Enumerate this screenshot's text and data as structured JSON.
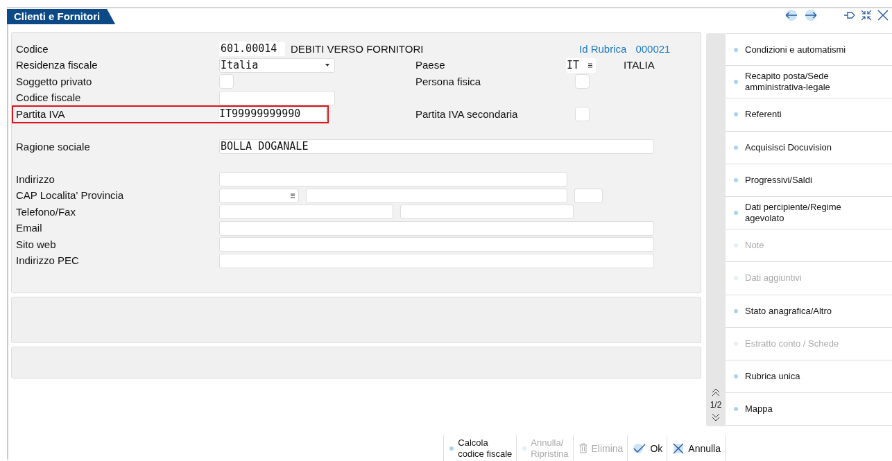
{
  "window": {
    "title": "Clienti e Fornitori"
  },
  "form": {
    "rows": [
      {
        "label": "Codice",
        "inputs": [
          {
            "kind": "code",
            "value": "601.00014"
          }
        ],
        "description": "DEBITI VERSO FORNITORI",
        "right": {
          "kind": "link",
          "label": "Id Rubrica",
          "value": "000021"
        }
      },
      {
        "label": "Residenza fiscale",
        "inputs": [
          {
            "kind": "select",
            "value": "Italia"
          }
        ],
        "right": {
          "kind": "lookup",
          "label": "Paese",
          "value": "IT",
          "description": "ITALIA"
        }
      },
      {
        "label": "Soggetto privato",
        "inputs": [
          {
            "kind": "checkbox",
            "checked": false
          }
        ],
        "right": {
          "kind": "checkbox",
          "label": "Persona fisica",
          "checked": false
        }
      },
      {
        "label": "Codice fiscale",
        "inputs": [
          {
            "kind": "text"
          }
        ]
      },
      {
        "label": "Partita IVA",
        "highlighted": true,
        "inputs": [
          {
            "kind": "text",
            "value": "IT99999999990"
          }
        ],
        "right": {
          "kind": "checkbox",
          "label": "Partita IVA secondaria",
          "checked": false
        }
      },
      {
        "label": "Ragione sociale",
        "gap_before": true,
        "inputs": [
          {
            "kind": "text",
            "value": "BOLLA DOGANALE"
          }
        ]
      },
      {
        "label": "Indirizzo",
        "gap_before": true,
        "inputs": [
          {
            "kind": "text"
          }
        ]
      },
      {
        "label": "CAP Localita' Provincia",
        "inputs": [
          {
            "kind": "lookup"
          },
          {
            "kind": "text"
          },
          {
            "kind": "text"
          }
        ]
      },
      {
        "label": "Telefono/Fax",
        "inputs": [
          {
            "kind": "text"
          },
          {
            "kind": "text"
          }
        ]
      },
      {
        "label": "Email",
        "inputs": [
          {
            "kind": "text"
          }
        ]
      },
      {
        "label": "Sito web",
        "inputs": [
          {
            "kind": "text"
          }
        ]
      },
      {
        "label": "Indirizzo PEC",
        "inputs": [
          {
            "kind": "text"
          }
        ]
      }
    ]
  },
  "pager": {
    "text": "1/2"
  },
  "sidebar": {
    "items": [
      {
        "label": "Condizioni e automatismi",
        "disabled": false
      },
      {
        "label": "Recapito posta/Sede amministrativa-legale",
        "disabled": false
      },
      {
        "label": "Referenti",
        "disabled": false
      },
      {
        "label": "Acquisisci Docuvision",
        "disabled": false
      },
      {
        "label": "Progressivi/Saldi",
        "disabled": false
      },
      {
        "label": "Dati percipiente/Regime agevolato",
        "disabled": false
      },
      {
        "label": "Note",
        "disabled": true
      },
      {
        "label": "Dati aggiuntivi",
        "disabled": true
      },
      {
        "label": "Stato anagrafica/Altro",
        "disabled": false
      },
      {
        "label": "Estratto conto / Schede",
        "disabled": true
      },
      {
        "label": "Rubrica unica",
        "disabled": false
      },
      {
        "label": "Mappa",
        "disabled": false
      }
    ]
  },
  "toolbar": {
    "buttons": [
      {
        "lines": [
          "Calcola",
          "codice fiscale"
        ],
        "kind": "dot",
        "disabled": false
      },
      {
        "lines": [
          "Annulla/",
          "Ripristina"
        ],
        "kind": "dot",
        "disabled": true
      },
      {
        "lines": [
          "Elimina"
        ],
        "kind": "trash",
        "disabled": true
      },
      {
        "lines": [
          "Ok"
        ],
        "kind": "check",
        "disabled": false
      },
      {
        "lines": [
          "Annulla"
        ],
        "kind": "cross",
        "disabled": false
      }
    ]
  }
}
